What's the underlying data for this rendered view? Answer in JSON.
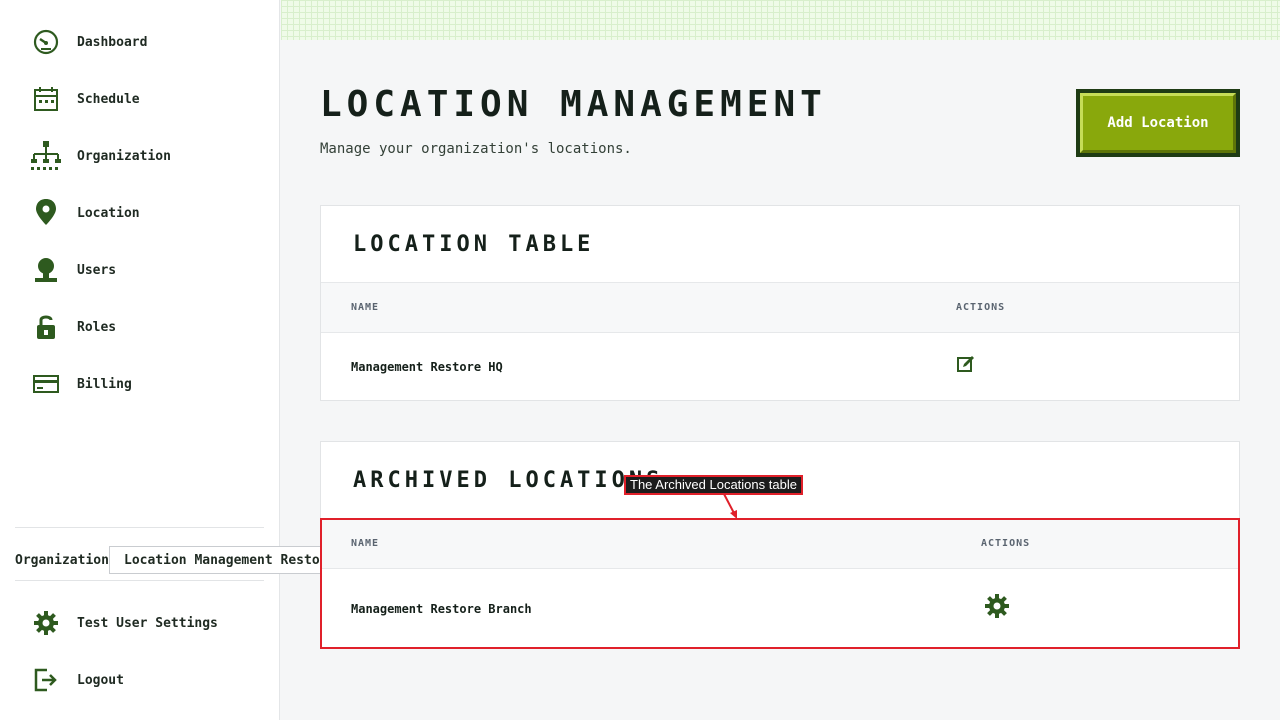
{
  "sidebar": {
    "items": [
      {
        "label": "Dashboard",
        "icon": "dashboard-gauge-icon"
      },
      {
        "label": "Schedule",
        "icon": "calendar-icon"
      },
      {
        "label": "Organization",
        "icon": "org-chart-icon"
      },
      {
        "label": "Location",
        "icon": "map-pin-icon"
      },
      {
        "label": "Users",
        "icon": "user-icon"
      },
      {
        "label": "Roles",
        "icon": "lock-icon"
      },
      {
        "label": "Billing",
        "icon": "credit-card-icon"
      }
    ],
    "org_label": "Organization",
    "org_value": "Location Management Restore Org",
    "footer": [
      {
        "label": "Test User Settings",
        "icon": "gear-icon"
      },
      {
        "label": "Logout",
        "icon": "logout-icon"
      }
    ]
  },
  "header": {
    "title": "Location Management",
    "subtitle": "Manage your organization's locations.",
    "add_button": "Add Location"
  },
  "location_table": {
    "title": "Location Table",
    "columns": [
      "NAME",
      "ACTIONS"
    ],
    "rows": [
      {
        "name": "Management Restore HQ",
        "action_icon": "edit-icon"
      }
    ]
  },
  "archived_table": {
    "title": "Archived Locations",
    "columns": [
      "NAME",
      "ACTIONS"
    ],
    "rows": [
      {
        "name": "Management Restore Branch",
        "action_icon": "gear-icon"
      }
    ]
  },
  "annotation": {
    "label": "The Archived Locations table",
    "color": "#e0202a"
  },
  "colors": {
    "accent": "#89a80c",
    "icon_green": "#2e5a1f",
    "button_border": "#1e3b14"
  }
}
